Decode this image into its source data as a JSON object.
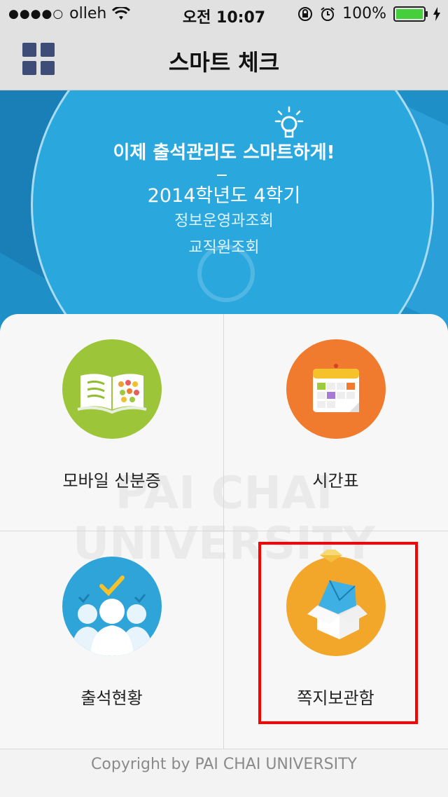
{
  "status_bar": {
    "signal_dots": "●●●●○",
    "carrier": "olleh",
    "time": "오전 10:07",
    "battery_percent": "100%"
  },
  "nav": {
    "title": "스마트 체크"
  },
  "banner": {
    "slogan": "이제 출석관리도 스마트하게!",
    "semester": "2014학년도 4학기",
    "department": "정보운영과조회",
    "role": "교직원조회"
  },
  "watermark": [
    "PAI CHAI",
    "UNIVERSITY"
  ],
  "tiles": {
    "mobile_id": {
      "label": "모바일 신분증",
      "color": "#9cc53a"
    },
    "timetable": {
      "label": "시간표",
      "color": "#f07a2e"
    },
    "attendance": {
      "label": "출석현황",
      "color": "#2fa4d8"
    },
    "inbox": {
      "label": "쪽지보관함",
      "color": "#f3a72a"
    }
  },
  "footer": {
    "copyright": "Copyright by PAI CHAI UNIVERSITY"
  },
  "icons": [
    "wifi-icon",
    "orientation-lock-icon",
    "alarm-icon",
    "battery-icon",
    "charging-icon",
    "grid-menu-icon",
    "lightbulb-icon",
    "book-icon",
    "calendar-icon",
    "people-check-icon",
    "mail-box-icon"
  ]
}
